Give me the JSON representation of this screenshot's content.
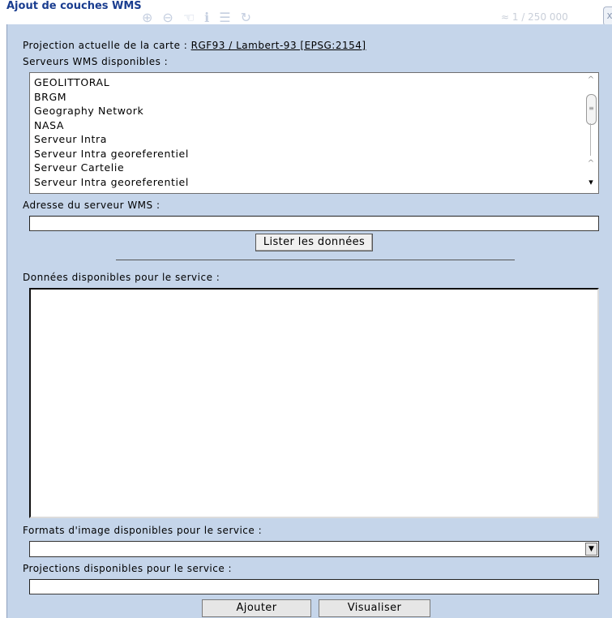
{
  "window": {
    "title": "Ajout de couches WMS",
    "close_label": "x",
    "background_scale": "≈ 1 / 250 000"
  },
  "projection": {
    "label": "Projection actuelle de la carte : ",
    "value": "RGF93 / Lambert-93 [EPSG:2154]"
  },
  "servers": {
    "label": "Serveurs WMS disponibles :",
    "items": [
      "GEOLITTORAL",
      "BRGM",
      "Geography Network",
      "NASA",
      "Serveur Intra",
      "Serveur Intra georeferentiel",
      "Serveur Cartelie",
      "Serveur Intra georeferentiel"
    ]
  },
  "address": {
    "label": "Adresse du serveur WMS :",
    "value": ""
  },
  "list_button": "Lister les données",
  "data": {
    "label": "Données disponibles pour le service :"
  },
  "formats": {
    "label": "Formats d'image disponibles pour le service :",
    "selected": ""
  },
  "projections": {
    "label": "Projections disponibles pour le service :",
    "value": ""
  },
  "buttons": {
    "add": "Ajouter",
    "view": "Visualiser"
  }
}
